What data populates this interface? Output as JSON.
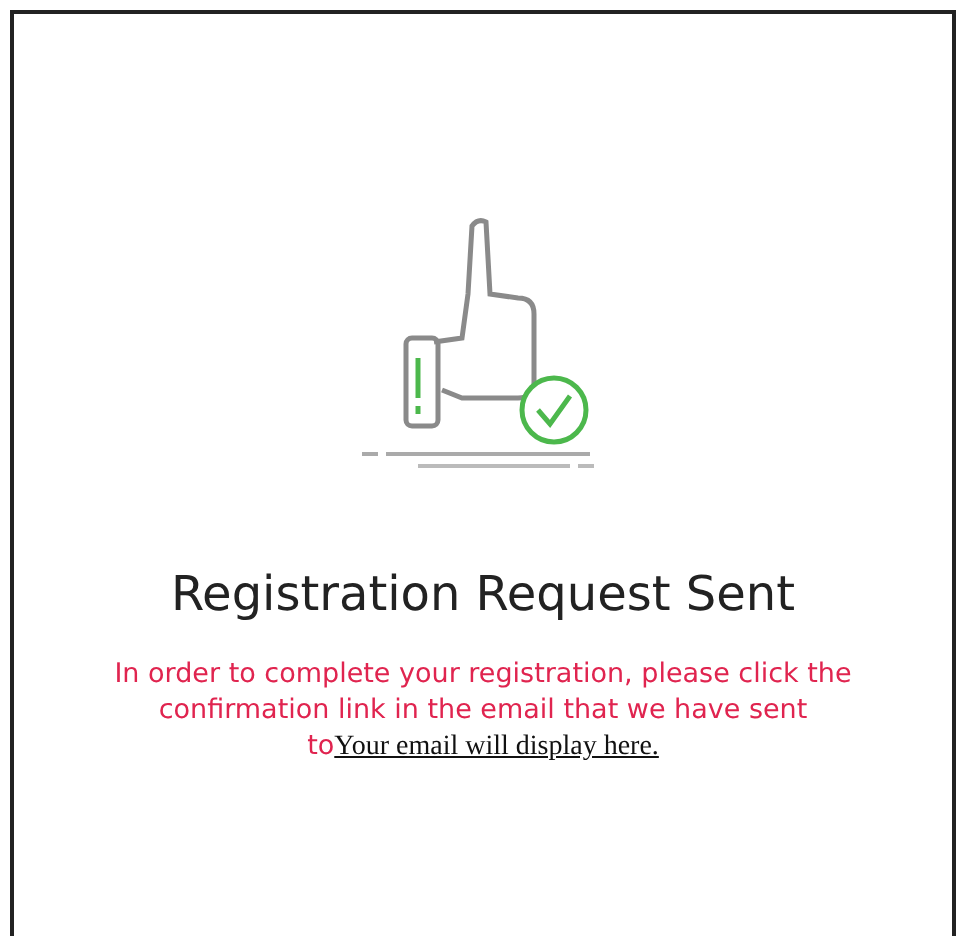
{
  "title": "Registration Request Sent",
  "message": "In order to complete your registration, please click the confirmation link in the email that we have sent to",
  "email_link": "Your email will display here."
}
